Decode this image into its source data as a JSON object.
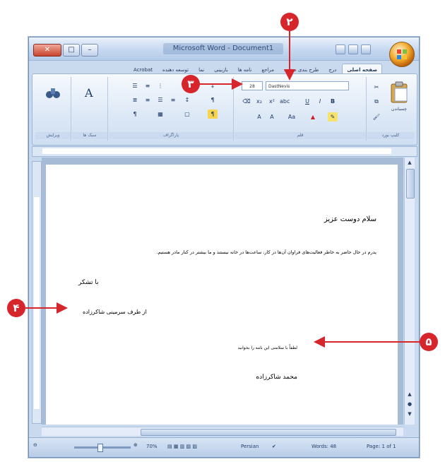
{
  "window": {
    "title": "Microsoft Word - Document1",
    "controls": [
      "✕",
      "□",
      "–"
    ]
  },
  "tabs": [
    "صفحه اصلی",
    "درج",
    "طرح بندی صفحه",
    "مراجع",
    "نامه ها",
    "بازبینی",
    "نما",
    "توسعه دهنده",
    "Acrobat"
  ],
  "ribbon": {
    "font_name": "DastNevis",
    "font_size": "28",
    "groups": {
      "clipboard": "کلیپ بورد",
      "font": "قلم",
      "paragraph": "پاراگراف",
      "styles": "سبک ها",
      "editing": "ویرایش"
    },
    "paste_label": "چسباندن"
  },
  "document": {
    "lines": [
      "سلام دوست عزیز",
      "پدرم در حال حاضر به خاطر فعالیت‌های فراوان آن‌ها در کار، ساعت‌ها در خانه نیستند و ما بیشتر در کنار مادر هستیم.",
      "با تشکر",
      "از طرف سرمینی شاکرزاده",
      "لطفاً با سلامتی این نامه را بخوانید",
      "محمد شاکرزاده"
    ]
  },
  "statusbar": {
    "page": "Page: 1 of 1",
    "words": "Words: 48",
    "language": "Persian",
    "zoom": "70%",
    "zoom_level": 0.45
  },
  "callouts": [
    "۲",
    "۳",
    "۴",
    "۵"
  ]
}
